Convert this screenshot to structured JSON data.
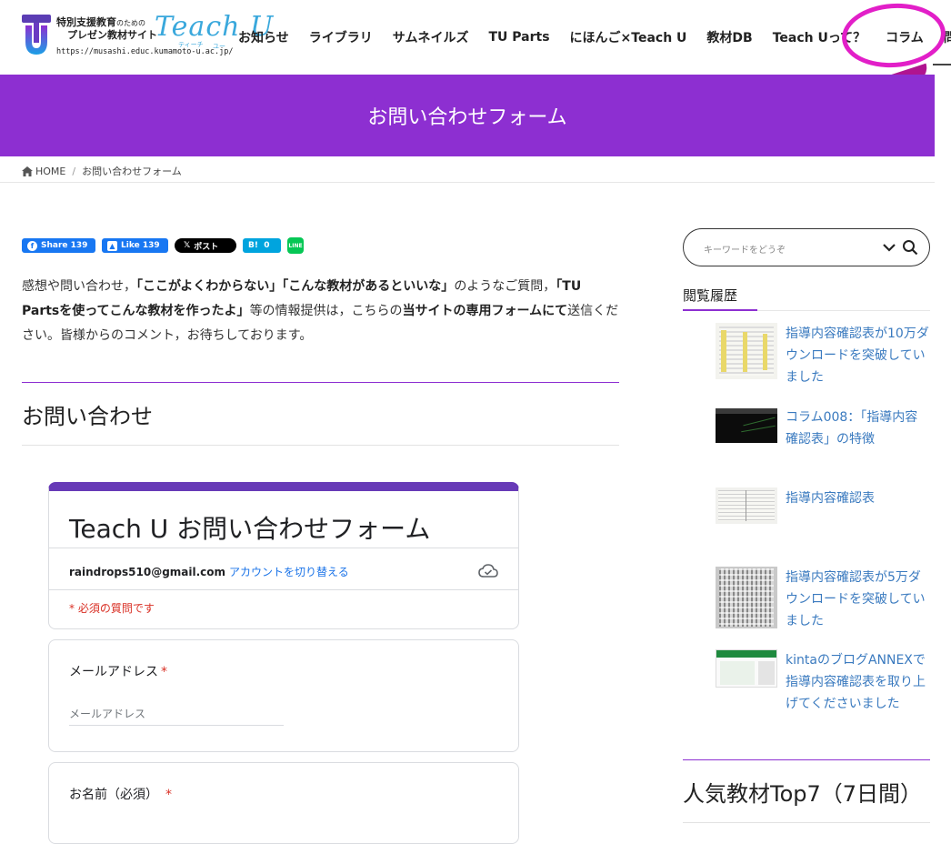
{
  "header": {
    "logo_line1": "特別支援教育",
    "logo_line1_small": "のための",
    "logo_line2": "プレゼン教材サイト",
    "logo_url": "https://musashi.educ.kumamoto-u.ac.jp/",
    "logo_brand": "Teach U",
    "logo_reading1": "ティーチ",
    "logo_reading2": "ユー",
    "nav": [
      {
        "label": "お知らせ"
      },
      {
        "label": "ライブラリ"
      },
      {
        "label": "サムネイルズ"
      },
      {
        "label": "TU Parts"
      },
      {
        "label": "にほんご×Teach U"
      },
      {
        "label": "教材DB"
      },
      {
        "label": "Teach Uって？"
      },
      {
        "label": "コラム"
      },
      {
        "label": "問合せ"
      }
    ]
  },
  "page": {
    "title": "お問い合わせフォーム",
    "breadcrumb_home": "HOME",
    "breadcrumb_current": "お問い合わせフォーム"
  },
  "share": {
    "fb": "Share",
    "fb_count": "139",
    "like": "Like",
    "like_count": "139",
    "x": "ポスト",
    "hatena": "B!",
    "hatena_count": "0",
    "line": "LINE"
  },
  "intro": {
    "p1": "感想や問い合わせ，",
    "b1": "「ここがよくわからない」「こんな教材があるといいな」",
    "p2": "のようなご質問，",
    "b2": "「TU Partsを使ってこんな教材を作ったよ」",
    "p3": "等の情報提供は，こちらの",
    "b3": "当サイトの専用フォームにて",
    "p4": "送信ください。皆様からのコメント，お待ちしております。"
  },
  "section_title": "お問い合わせ",
  "form": {
    "title": "Teach U お問い合わせフォーム",
    "email": "raindrops510@gmail.com",
    "switch_account": "アカウントを切り替える",
    "required_note": "* 必須の質問です",
    "questions": [
      {
        "label": "メールアドレス",
        "star": "*",
        "placeholder": "メールアドレス"
      },
      {
        "label": "お名前（必須）",
        "star": "*"
      }
    ]
  },
  "sidebar": {
    "search_placeholder": "キーワードをどうぞ",
    "history_title": "閲覧履歴",
    "history": [
      {
        "title": "指導内容確認表が10万ダウンロードを突破していました"
      },
      {
        "title": "コラム008：「指導内容確認表」の特徴"
      },
      {
        "title": "指導内容確認表"
      },
      {
        "title": "指導内容確認表が5万ダウンロードを突破していました"
      },
      {
        "title": "kintaのブログANNEXで指導内容確認表を取り上げてくださいました"
      }
    ],
    "popular_title": "人気教材Top7（7日間）"
  },
  "colors": {
    "accent": "#8d2fd1",
    "form_accent": "#673ab7",
    "annotation": "#e21fc8",
    "link": "#3a7abf"
  }
}
